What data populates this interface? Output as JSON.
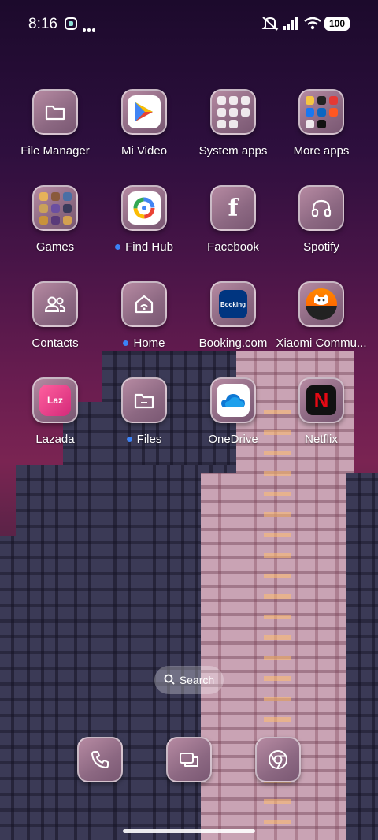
{
  "status_bar": {
    "time": "8:16",
    "battery": "100",
    "icons": [
      "app-notification-icon",
      "more-dots-icon",
      "mute-icon",
      "signal-icon",
      "wifi-icon",
      "battery-icon"
    ]
  },
  "apps": [
    {
      "label": "File Manager",
      "icon": "folder-icon"
    },
    {
      "label": "Mi Video",
      "icon": "play-icon"
    },
    {
      "label": "System apps",
      "icon": "folder-grid-icon"
    },
    {
      "label": "More apps",
      "icon": "folder-grid-icon"
    },
    {
      "label": "Games",
      "icon": "folder-grid-icon"
    },
    {
      "label": "Find Hub",
      "icon": "find-hub-icon",
      "new": true
    },
    {
      "label": "Facebook",
      "icon": "facebook-icon"
    },
    {
      "label": "Spotify",
      "icon": "headphones-icon"
    },
    {
      "label": "Contacts",
      "icon": "contacts-icon"
    },
    {
      "label": "Home",
      "icon": "home-icon",
      "new": true
    },
    {
      "label": "Booking.com",
      "icon": "booking-icon",
      "logo_text": "Booking"
    },
    {
      "label": "Xiaomi Commu...",
      "icon": "xiaomi-community-icon"
    },
    {
      "label": "Lazada",
      "icon": "lazada-icon",
      "logo_text": "Laz"
    },
    {
      "label": "Files",
      "icon": "files-icon",
      "new": true
    },
    {
      "label": "OneDrive",
      "icon": "onedrive-icon"
    },
    {
      "label": "Netflix",
      "icon": "netflix-icon",
      "logo_text": "N"
    }
  ],
  "search": {
    "label": "Search"
  },
  "dock": [
    {
      "icon": "phone-icon"
    },
    {
      "icon": "messages-icon"
    },
    {
      "icon": "chrome-icon"
    }
  ],
  "colors": {
    "new_dot": "#3b82f6",
    "booking": "#003580",
    "netflix": "#e50914",
    "lazada": "#f0457d"
  }
}
